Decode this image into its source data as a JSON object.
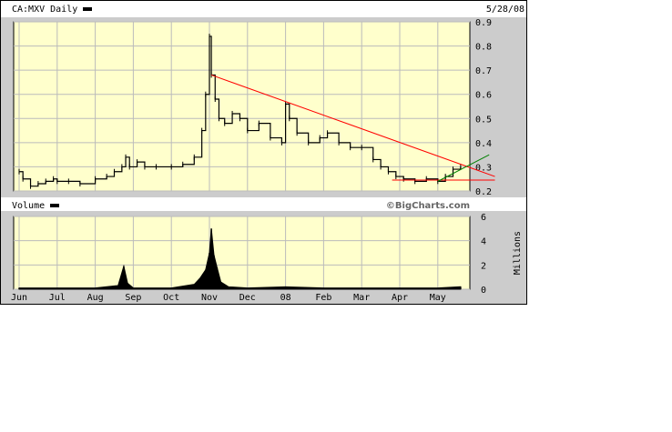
{
  "header": {
    "symbol_label": "CA:MXV Daily",
    "date": "5/28/08"
  },
  "volume_panel": {
    "label": "Volume",
    "watermark": "©BigCharts.com",
    "unit_label": "Millions"
  },
  "colors": {
    "panel_bg": "#ffffcc",
    "frame_bg": "#cccccc",
    "trend_line": "#ff0000",
    "support_line": "#ff0000",
    "uptrend_line": "#008000",
    "price": "#000000"
  },
  "chart_data": [
    {
      "type": "line",
      "title": "CA:MXV Daily",
      "x_tick_labels": [
        "Jun",
        "Jul",
        "Aug",
        "Sep",
        "Oct",
        "Nov",
        "Dec",
        "08",
        "Feb",
        "Mar",
        "Apr",
        "May"
      ],
      "y_ticks": [
        0.2,
        0.3,
        0.4,
        0.5,
        0.6,
        0.7,
        0.8,
        0.9
      ],
      "ylim": [
        0.2,
        0.9
      ],
      "grid": true,
      "series": [
        {
          "month_index": [
            0,
            0.1,
            0.3,
            0.5,
            0.7,
            0.9,
            1.0,
            1.3,
            1.6,
            2.0,
            2.3,
            2.5,
            2.7,
            2.8,
            2.9,
            3.1,
            3.3,
            3.6,
            4.0,
            4.3,
            4.6,
            4.8,
            4.9,
            5.0,
            5.05,
            5.15,
            5.25,
            5.4,
            5.6,
            5.8,
            6.0,
            6.3,
            6.6,
            6.9,
            7.0,
            7.1,
            7.3,
            7.6,
            7.9,
            8.1,
            8.4,
            8.7,
            9.0,
            9.3,
            9.5,
            9.7,
            9.9,
            10.1,
            10.4,
            10.7,
            11.0,
            11.2,
            11.4,
            11.6
          ],
          "values": [
            0.28,
            0.25,
            0.22,
            0.23,
            0.24,
            0.25,
            0.24,
            0.24,
            0.23,
            0.25,
            0.26,
            0.28,
            0.3,
            0.34,
            0.3,
            0.32,
            0.3,
            0.3,
            0.3,
            0.31,
            0.34,
            0.45,
            0.6,
            0.84,
            0.68,
            0.58,
            0.5,
            0.48,
            0.52,
            0.5,
            0.45,
            0.48,
            0.42,
            0.4,
            0.56,
            0.5,
            0.44,
            0.4,
            0.42,
            0.44,
            0.4,
            0.38,
            0.38,
            0.33,
            0.3,
            0.28,
            0.26,
            0.25,
            0.24,
            0.25,
            0.24,
            0.26,
            0.29,
            0.3
          ]
        }
      ],
      "trendlines": [
        {
          "color": "red",
          "from": [
            5.05,
            0.68
          ],
          "to": [
            12.5,
            0.26
          ]
        },
        {
          "color": "red",
          "from": [
            9.8,
            0.245
          ],
          "to": [
            12.5,
            0.245
          ]
        },
        {
          "color": "green",
          "from": [
            11.0,
            0.24
          ],
          "to": [
            12.35,
            0.35
          ]
        }
      ]
    },
    {
      "type": "area",
      "title": "Volume",
      "ylabel": "Millions",
      "y_ticks": [
        0,
        2,
        4,
        6
      ],
      "ylim": [
        0,
        6
      ],
      "series": [
        {
          "name": "Volume",
          "month_index": [
            0,
            1.0,
            2.0,
            2.6,
            2.75,
            2.85,
            3.0,
            4.0,
            4.6,
            4.75,
            4.9,
            5.0,
            5.05,
            5.12,
            5.2,
            5.3,
            5.5,
            6.0,
            7.0,
            8.0,
            9.0,
            10.0,
            11.0,
            11.6
          ],
          "values": [
            0.1,
            0.1,
            0.1,
            0.3,
            1.9,
            0.5,
            0.1,
            0.1,
            0.4,
            0.9,
            1.6,
            3.0,
            5.0,
            2.8,
            1.8,
            0.6,
            0.2,
            0.1,
            0.2,
            0.1,
            0.1,
            0.1,
            0.1,
            0.2
          ]
        }
      ]
    }
  ]
}
